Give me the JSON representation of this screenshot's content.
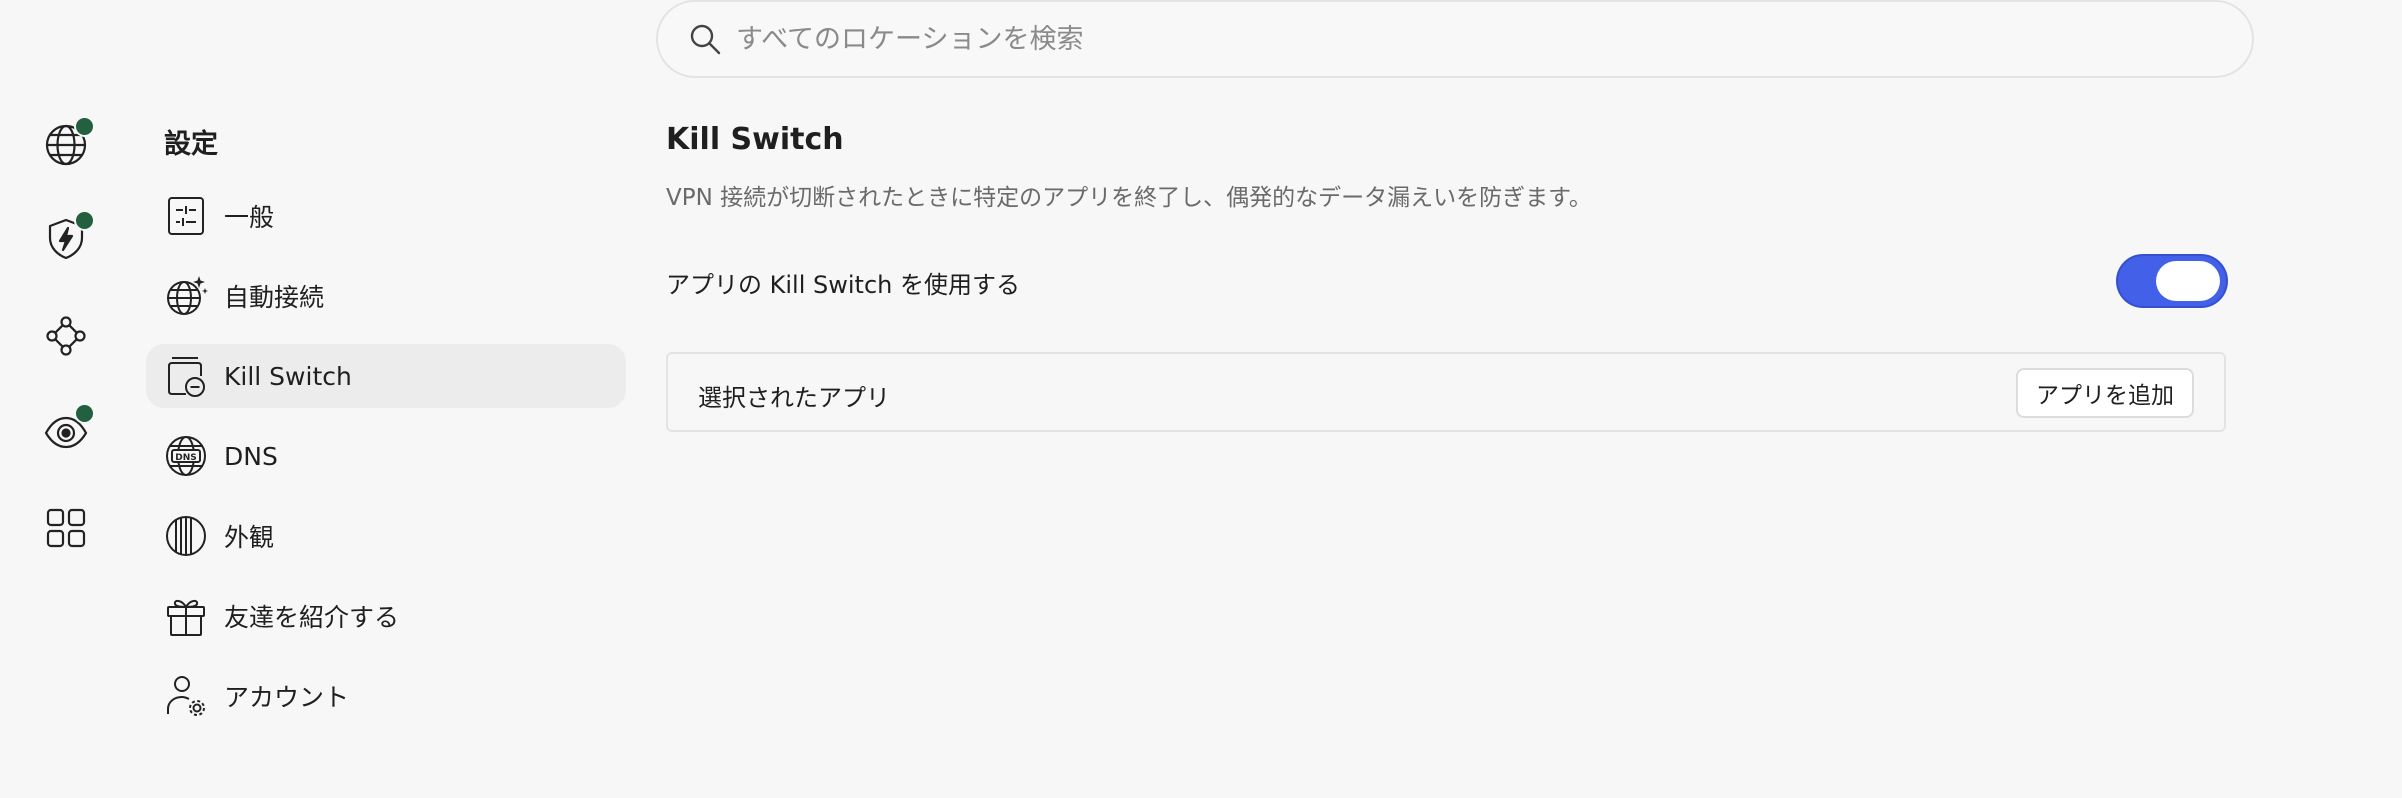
{
  "search": {
    "placeholder": "すべてのロケーションを検索",
    "icon": "search-icon"
  },
  "rail": {
    "items": [
      {
        "icon": "globe-icon",
        "badge": true
      },
      {
        "icon": "shield-bolt-icon",
        "badge": true
      },
      {
        "icon": "meshnet-icon",
        "badge": false
      },
      {
        "icon": "eye-icon",
        "badge": true
      },
      {
        "icon": "apps-grid-icon",
        "badge": false
      }
    ],
    "badge_color": "#22603f"
  },
  "sidebar": {
    "title": "設定",
    "items": [
      {
        "label": "一般",
        "icon": "sliders-icon",
        "active": false
      },
      {
        "label": "自動接続",
        "icon": "globe-sparkle-icon",
        "active": false
      },
      {
        "label": "Kill Switch",
        "icon": "kill-switch-icon",
        "active": true
      },
      {
        "label": "DNS",
        "icon": "dns-globe-icon",
        "active": false
      },
      {
        "label": "外観",
        "icon": "appearance-icon",
        "active": false
      },
      {
        "label": "友達を紹介する",
        "icon": "gift-icon",
        "active": false
      },
      {
        "label": "アカウント",
        "icon": "account-settings-icon",
        "active": false
      }
    ]
  },
  "main": {
    "title": "Kill Switch",
    "description": "VPN 接続が切断されたときに特定のアプリを終了し、偶発的なデータ漏えいを防ぎます。",
    "toggle_label": "アプリの Kill Switch を使用する",
    "toggle_on": true,
    "selected_apps_label": "選択されたアプリ",
    "add_app_label": "アプリを追加"
  },
  "colors": {
    "accent": "#4260e8",
    "badge": "#22603f",
    "background": "#f7f7f7"
  }
}
